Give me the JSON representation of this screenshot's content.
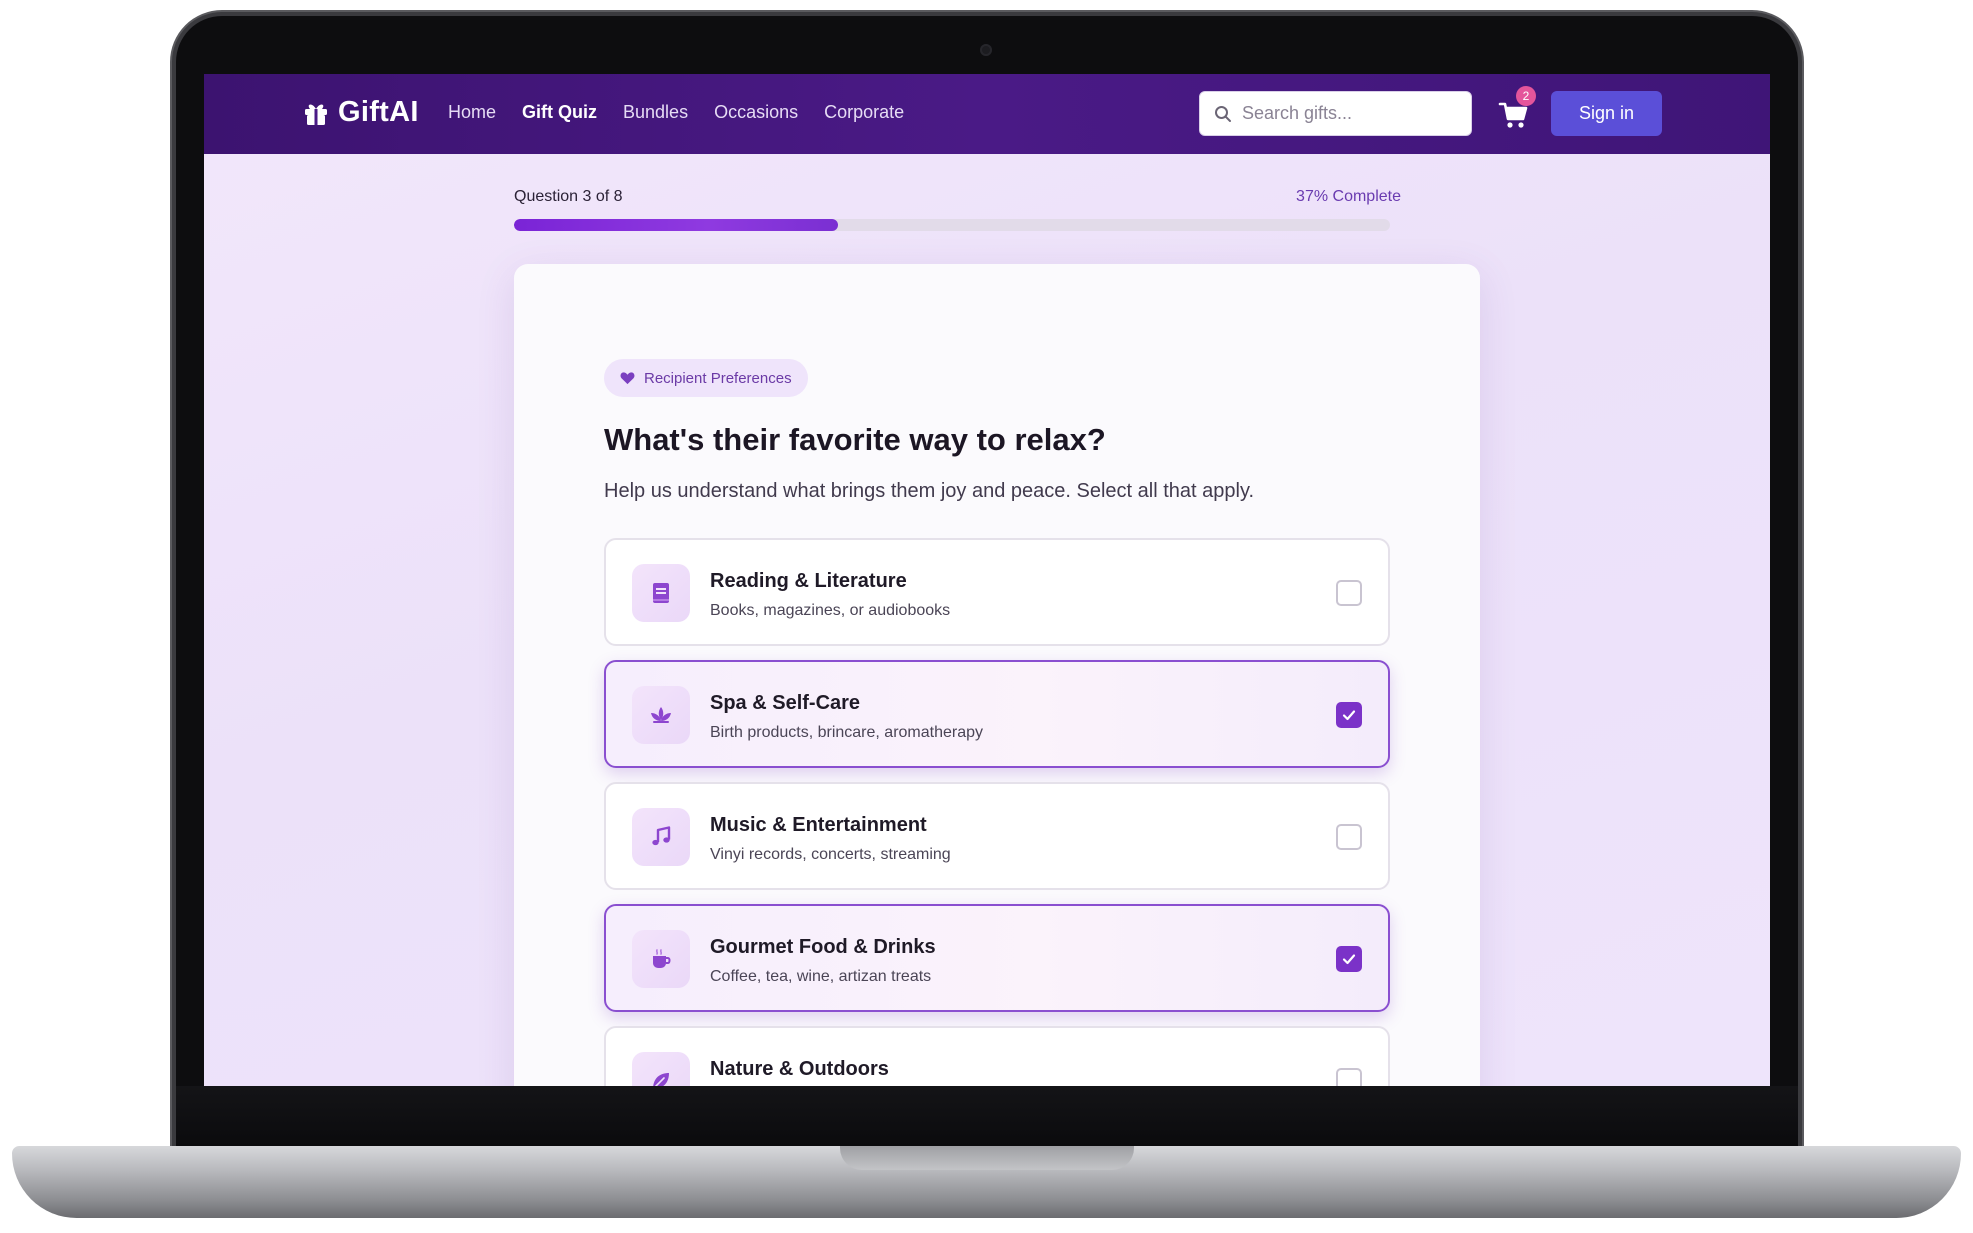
{
  "nav": {
    "brand": "GiftAI",
    "brand_icon": "gift-icon",
    "links": [
      {
        "label": "Home",
        "active": false
      },
      {
        "label": "Gift Quiz",
        "active": true
      },
      {
        "label": "Bundles",
        "active": false
      },
      {
        "label": "Occasions",
        "active": false
      },
      {
        "label": "Corporate",
        "active": false
      }
    ],
    "search_placeholder": "Search gifts...",
    "search_icon": "search-icon",
    "cart_icon": "cart-icon",
    "cart_count": "2",
    "sign_in": "Sign in"
  },
  "progress": {
    "label": "Question 3 of 8",
    "percent_text": "37% Complete",
    "fraction": 0.37
  },
  "quiz": {
    "category_icon": "heart-icon",
    "category": "Recipient Preferences",
    "question": "What's their favorite way to relax?",
    "helper": "Help us understand what brings them joy and peace. Select all that apply.",
    "options": [
      {
        "icon": "book-icon",
        "title": "Reading & Literature",
        "desc": "Books, magazines, or audiobooks",
        "selected": false
      },
      {
        "icon": "lotus-icon",
        "title": "Spa & Self-Care",
        "desc": "Birth products, brincare, aromatherapy",
        "selected": true
      },
      {
        "icon": "music-note-icon",
        "title": "Music & Entertainment",
        "desc": "Vinyi records, concerts, streaming",
        "selected": false
      },
      {
        "icon": "coffee-cup-icon",
        "title": "Gourmet Food & Drinks",
        "desc": "Coffee, tea, wine, artizan treats",
        "selected": true
      },
      {
        "icon": "leaf-icon",
        "title": "Nature & Outdoors",
        "desc": "",
        "selected": false
      }
    ]
  },
  "colors": {
    "nav_bg": "#4a1a86",
    "accent": "#7b32c8",
    "sign_in_bg": "#5b4fd8",
    "badge": "#e4559b"
  }
}
